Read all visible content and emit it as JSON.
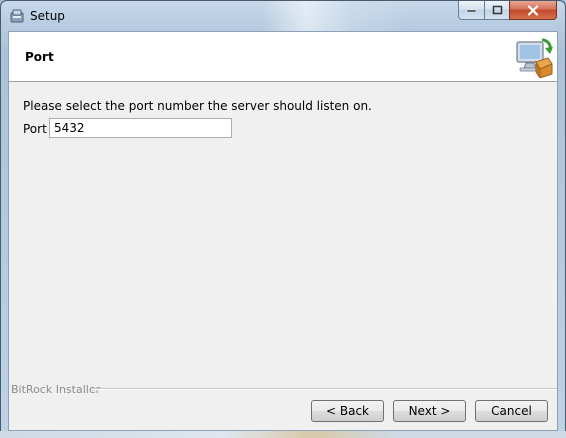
{
  "window": {
    "title": "Setup",
    "app_icon": "setup-installer-icon",
    "controls": {
      "minimize_icon": "minimize-icon",
      "maximize_icon": "maximize-icon",
      "close_icon": "close-icon"
    }
  },
  "header": {
    "title": "Port",
    "logo_icon": "computer-install-icon"
  },
  "main": {
    "prompt": "Please select the port number the server should listen on.",
    "port_label": "Port",
    "port_value": "5432"
  },
  "footer": {
    "brand": "BitRock Installer",
    "back_label": "< Back",
    "next_label": "Next >",
    "cancel_label": "Cancel"
  },
  "colors": {
    "close_button": "#c34a2c",
    "header_bg": "#ffffff",
    "client_bg": "#f0f0f0"
  }
}
